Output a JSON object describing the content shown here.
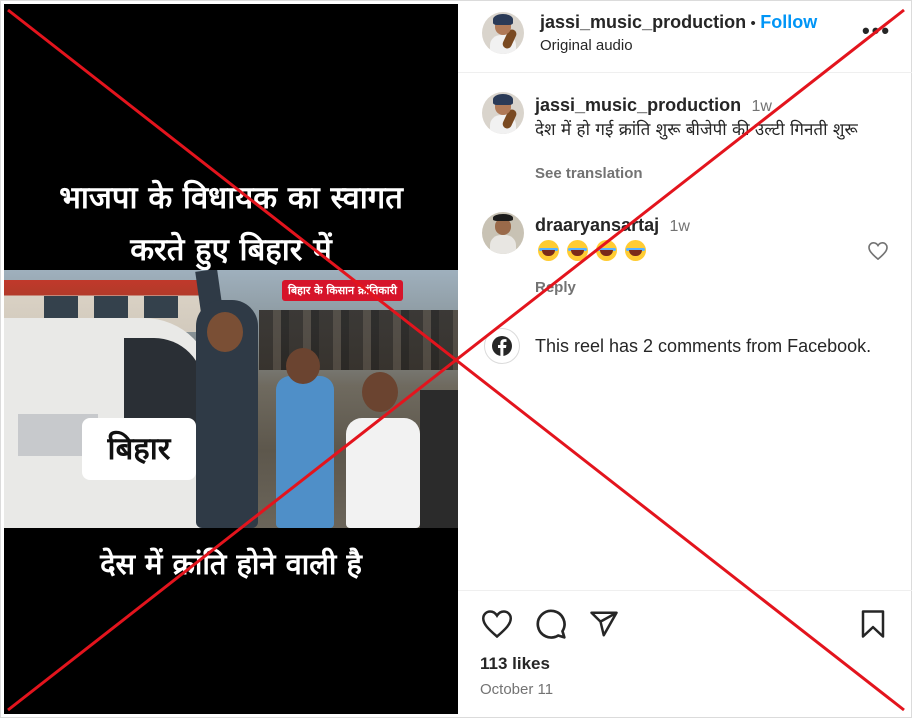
{
  "media": {
    "caption_top_line1": "भाजपा के विधायक का स्वागत",
    "caption_top_line2": "करते हुए बिहार में",
    "red_tag": "बिहार के किसान क्रांतिकारी",
    "location_label": "बिहार",
    "caption_bottom": "देस में क्रांति होने वाली है"
  },
  "header": {
    "username": "jassi_music_production",
    "separator": "•",
    "follow_label": "Follow",
    "audio": "Original audio",
    "more_label": "•••"
  },
  "comments": [
    {
      "username": "jassi_music_production",
      "time": "1w",
      "text": "देश में हो गई क्रांति शुरू बीजेपी की उल्टी गिनती शुरू",
      "see_translation": "See translation"
    },
    {
      "username": "draaryansartaj",
      "time": "1w",
      "emojis": "😂😂😂😂",
      "reply_label": "Reply"
    }
  ],
  "facebook_note": "This reel has 2 comments from Facebook.",
  "footer": {
    "likes": "113 likes",
    "date": "October 11"
  },
  "icons": [
    "heart-icon",
    "comment-icon",
    "share-icon",
    "bookmark-icon",
    "facebook-icon",
    "more-icon"
  ],
  "colors": {
    "follow": "#0095f6",
    "muted": "#737373",
    "cross": "#e3141d"
  }
}
